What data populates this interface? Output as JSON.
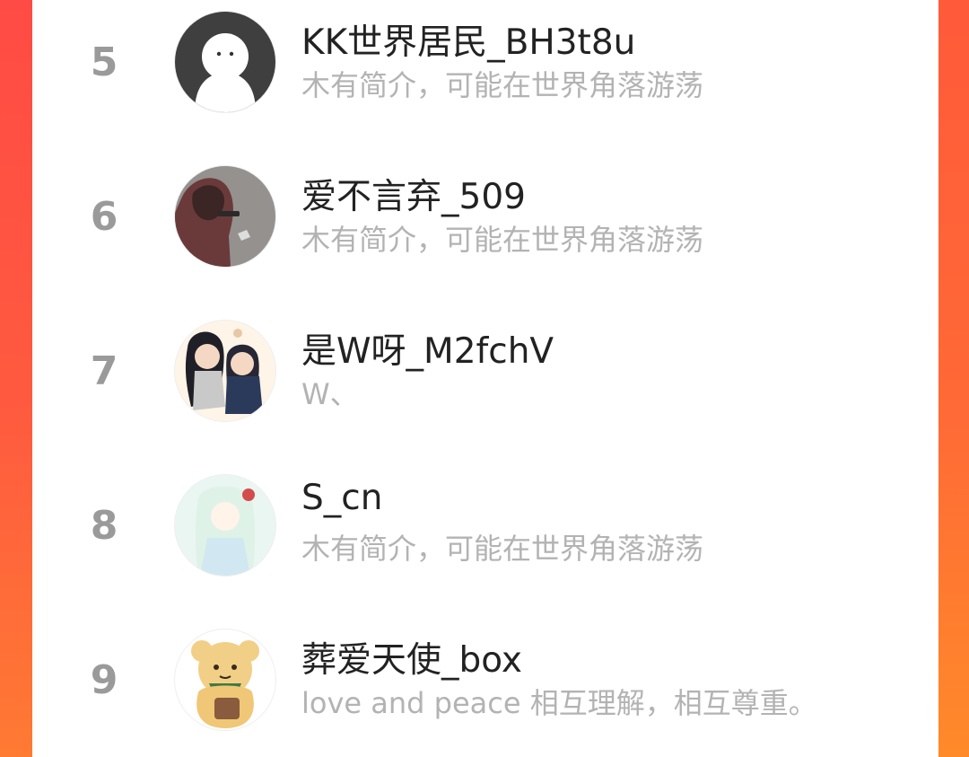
{
  "ranking": {
    "items": [
      {
        "rank": "5",
        "name": "KK世界居民_BH3t8u",
        "bio": "木有简介，可能在世界角落游荡",
        "avatar_icon": "default-ghost-avatar"
      },
      {
        "rank": "6",
        "name": "爱不言弃_509",
        "bio": "木有简介，可能在世界角落游荡",
        "avatar_icon": "hooded-figure-photo-avatar"
      },
      {
        "rank": "7",
        "name": "是W呀_M2fchV",
        "bio": "W、",
        "avatar_icon": "anime-couple-avatar"
      },
      {
        "rank": "8",
        "name": "S_cn",
        "bio": "木有简介，可能在世界角落游荡",
        "avatar_icon": "anime-girl-avatar"
      },
      {
        "rank": "9",
        "name": "葬爱天使_box",
        "bio": "love and peace 相互理解，相互尊重。",
        "avatar_icon": "teddy-bear-avatar"
      }
    ]
  },
  "colors": {
    "background_gradient_top": "#ff4a3e",
    "background_gradient_bottom": "#ff7a2f",
    "panel": "#ffffff",
    "rank_text": "#9a9a9a",
    "name_text": "#222222",
    "bio_text": "#b3b3b3"
  }
}
